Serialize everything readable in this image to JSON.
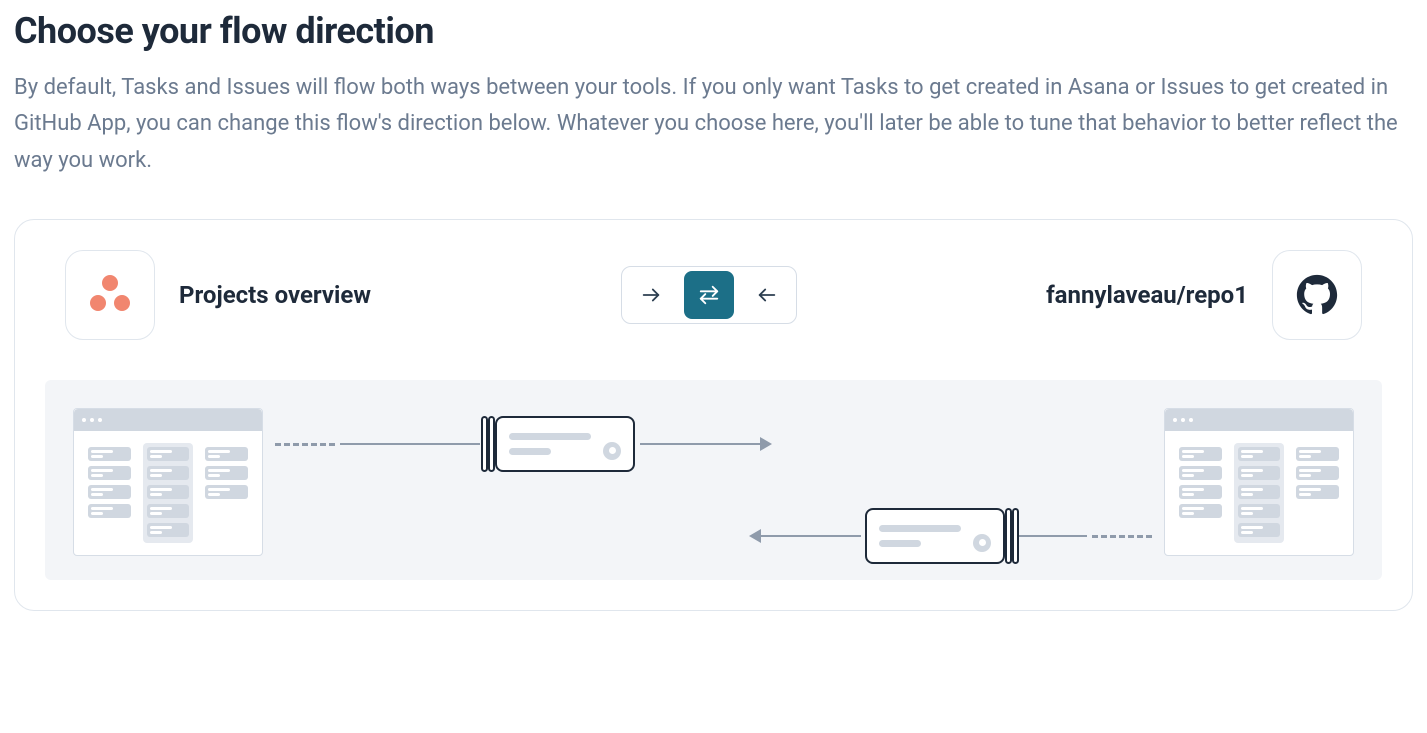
{
  "header": {
    "title": "Choose your flow direction",
    "description": "By default, Tasks and Issues will flow both ways between your tools. If you only want Tasks to get created in Asana or Issues to get created in GitHub App, you can change this flow's direction below. Whatever you choose here, you'll later be able to tune that behavior to better reflect the way you work."
  },
  "flow": {
    "leftTool": {
      "name": "Projects overview",
      "provider": "asana"
    },
    "rightTool": {
      "name": "fannylaveau/repo1",
      "provider": "github"
    },
    "direction": {
      "options": [
        "one-way-right",
        "two-way",
        "one-way-left"
      ],
      "selected": "two-way"
    }
  }
}
